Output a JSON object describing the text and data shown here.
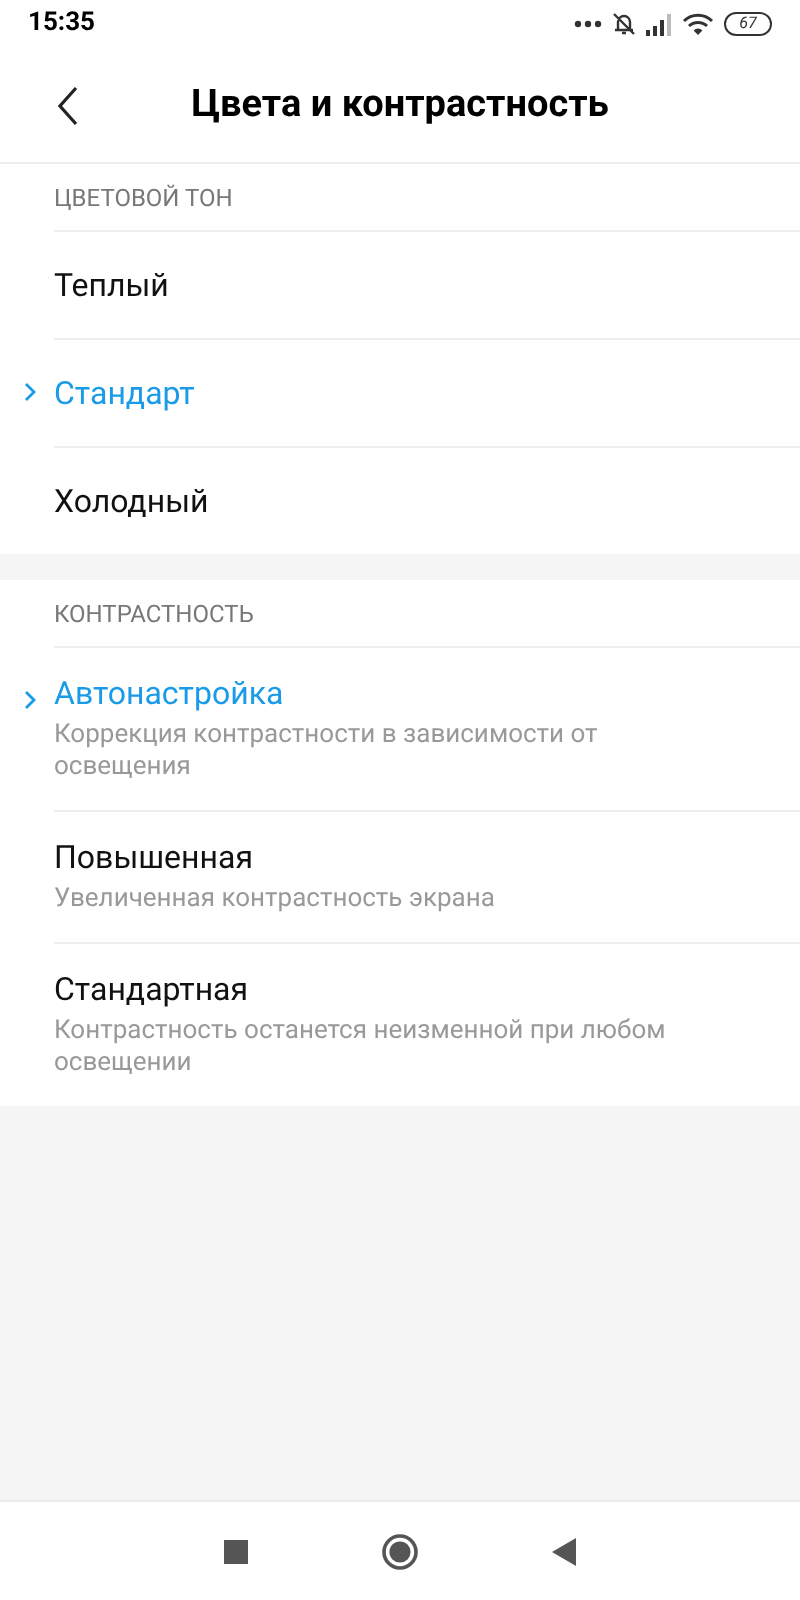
{
  "status_bar": {
    "time": "15:35",
    "battery": "67"
  },
  "header": {
    "title": "Цвета и контрастность"
  },
  "sections": [
    {
      "title": "ЦВЕТОВОЙ ТОН",
      "items": [
        {
          "label": "Теплый",
          "selected": false
        },
        {
          "label": "Стандарт",
          "selected": true
        },
        {
          "label": "Холодный",
          "selected": false
        }
      ]
    },
    {
      "title": "КОНТРАСТНОСТЬ",
      "items": [
        {
          "label": "Автонастройка",
          "description": "Коррекция контрастности в зависимости от освещения",
          "selected": true
        },
        {
          "label": "Повышенная",
          "description": "Увеличенная контрастность экрана",
          "selected": false
        },
        {
          "label": "Стандартная",
          "description": "Контрастность останется неизменной при любом освещении",
          "selected": false
        }
      ]
    }
  ]
}
